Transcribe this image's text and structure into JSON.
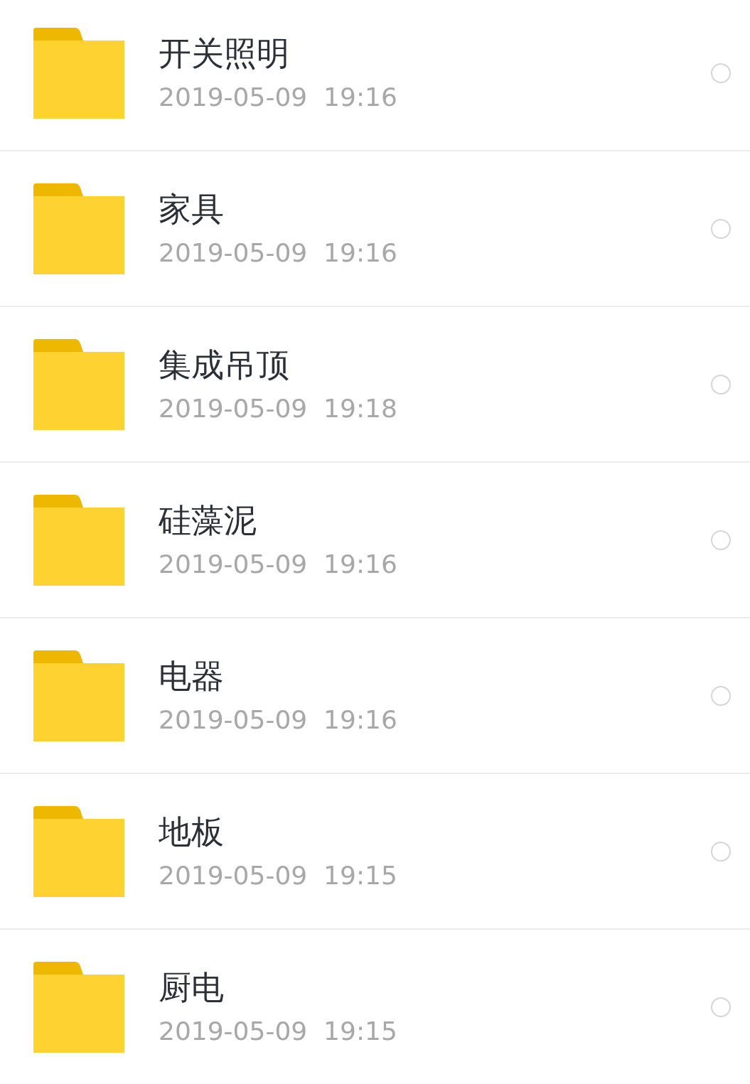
{
  "folders": [
    {
      "name": "开关照明",
      "modified": "2019-05-09  19:16",
      "selected": false
    },
    {
      "name": "家具",
      "modified": "2019-05-09  19:16",
      "selected": false
    },
    {
      "name": "集成吊顶",
      "modified": "2019-05-09  19:18",
      "selected": false
    },
    {
      "name": "硅藻泥",
      "modified": "2019-05-09  19:16",
      "selected": false
    },
    {
      "name": "电器",
      "modified": "2019-05-09  19:16",
      "selected": false
    },
    {
      "name": "地板",
      "modified": "2019-05-09  19:15",
      "selected": false
    },
    {
      "name": "厨电",
      "modified": "2019-05-09  19:15",
      "selected": false
    }
  ]
}
